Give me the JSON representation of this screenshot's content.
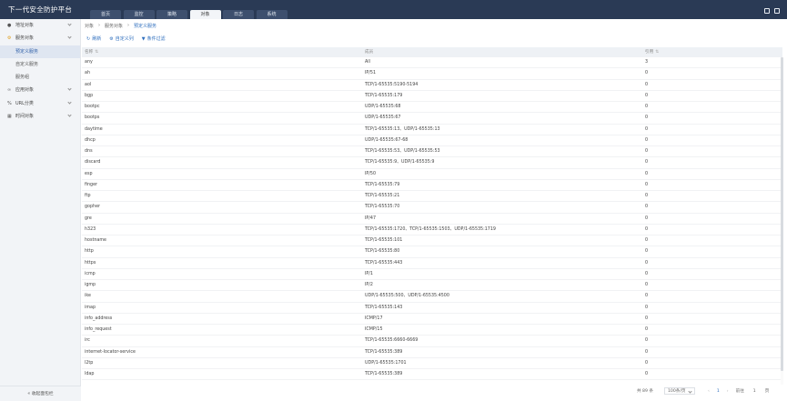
{
  "app": {
    "title": "下一代安全防护平台"
  },
  "tabs": [
    "首页",
    "监控",
    "策略",
    "对象",
    "日志",
    "系统"
  ],
  "active_tab": 3,
  "sidebar": {
    "items": [
      {
        "label": "地址对象",
        "icon": "map-pin-icon"
      },
      {
        "label": "服务对象",
        "icon": "gear-icon",
        "children": [
          "预定义服务",
          "自定义服务",
          "服务组"
        ]
      },
      {
        "label": "应用对象",
        "icon": "link-icon"
      },
      {
        "label": "URL分类",
        "icon": "url-icon"
      },
      {
        "label": "时间对象",
        "icon": "calendar-icon"
      }
    ],
    "active_child": "预定义服务",
    "bottom_label": "« 收起面包栏"
  },
  "breadcrumb": [
    "对象",
    "服务对象",
    "预定义服务"
  ],
  "toolbar": {
    "refresh": "刷新",
    "custom_columns": "自定义列",
    "filter": "条件过滤"
  },
  "table": {
    "headers": [
      "名称",
      "成员",
      "引用"
    ],
    "rows": [
      [
        "any",
        "All",
        "3"
      ],
      [
        "ah",
        "IP/51",
        "0"
      ],
      [
        "aol",
        "TCP/1-65535:5190-5194",
        "0"
      ],
      [
        "bgp",
        "TCP/1-65535:179",
        "0"
      ],
      [
        "bootpc",
        "UDP/1-65535:68",
        "0"
      ],
      [
        "bootps",
        "UDP/1-65535:67",
        "0"
      ],
      [
        "daytime",
        "TCP/1-65535:13、UDP/1-65535:13",
        "0"
      ],
      [
        "dhcp",
        "UDP/1-65535:67-68",
        "0"
      ],
      [
        "dns",
        "TCP/1-65535:53、UDP/1-65535:53",
        "0"
      ],
      [
        "discard",
        "TCP/1-65535:9、UDP/1-65535:9",
        "0"
      ],
      [
        "esp",
        "IP/50",
        "0"
      ],
      [
        "finger",
        "TCP/1-65535:79",
        "0"
      ],
      [
        "ftp",
        "TCP/1-65535:21",
        "0"
      ],
      [
        "gopher",
        "TCP/1-65535:70",
        "0"
      ],
      [
        "gre",
        "IP/47",
        "0"
      ],
      [
        "h323",
        "TCP/1-65535:1720、TCP/1-65535:1503、UDP/1-65535:1719",
        "0"
      ],
      [
        "hostname",
        "TCP/1-65535:101",
        "0"
      ],
      [
        "http",
        "TCP/1-65535:80",
        "0"
      ],
      [
        "https",
        "TCP/1-65535:443",
        "0"
      ],
      [
        "icmp",
        "IP/1",
        "0"
      ],
      [
        "igmp",
        "IP/2",
        "0"
      ],
      [
        "ike",
        "UDP/1-65535:500、UDP/1-65535:4500",
        "0"
      ],
      [
        "imap",
        "TCP/1-65535:143",
        "0"
      ],
      [
        "info_address",
        "ICMP/17",
        "0"
      ],
      [
        "info_request",
        "ICMP/15",
        "0"
      ],
      [
        "irc",
        "TCP/1-65535:6660-6669",
        "0"
      ],
      [
        "internet-locator-service",
        "TCP/1-65535:389",
        "0"
      ],
      [
        "l2tp",
        "UDP/1-65535:1701",
        "0"
      ],
      [
        "ldap",
        "TCP/1-65535:389",
        "0"
      ]
    ]
  },
  "pager": {
    "total": "共 89 条",
    "page_size": "100条/页",
    "prev": "‹",
    "current": "1",
    "next": "›",
    "goto_label": "前往",
    "goto_value": "1",
    "page_unit": "页"
  }
}
